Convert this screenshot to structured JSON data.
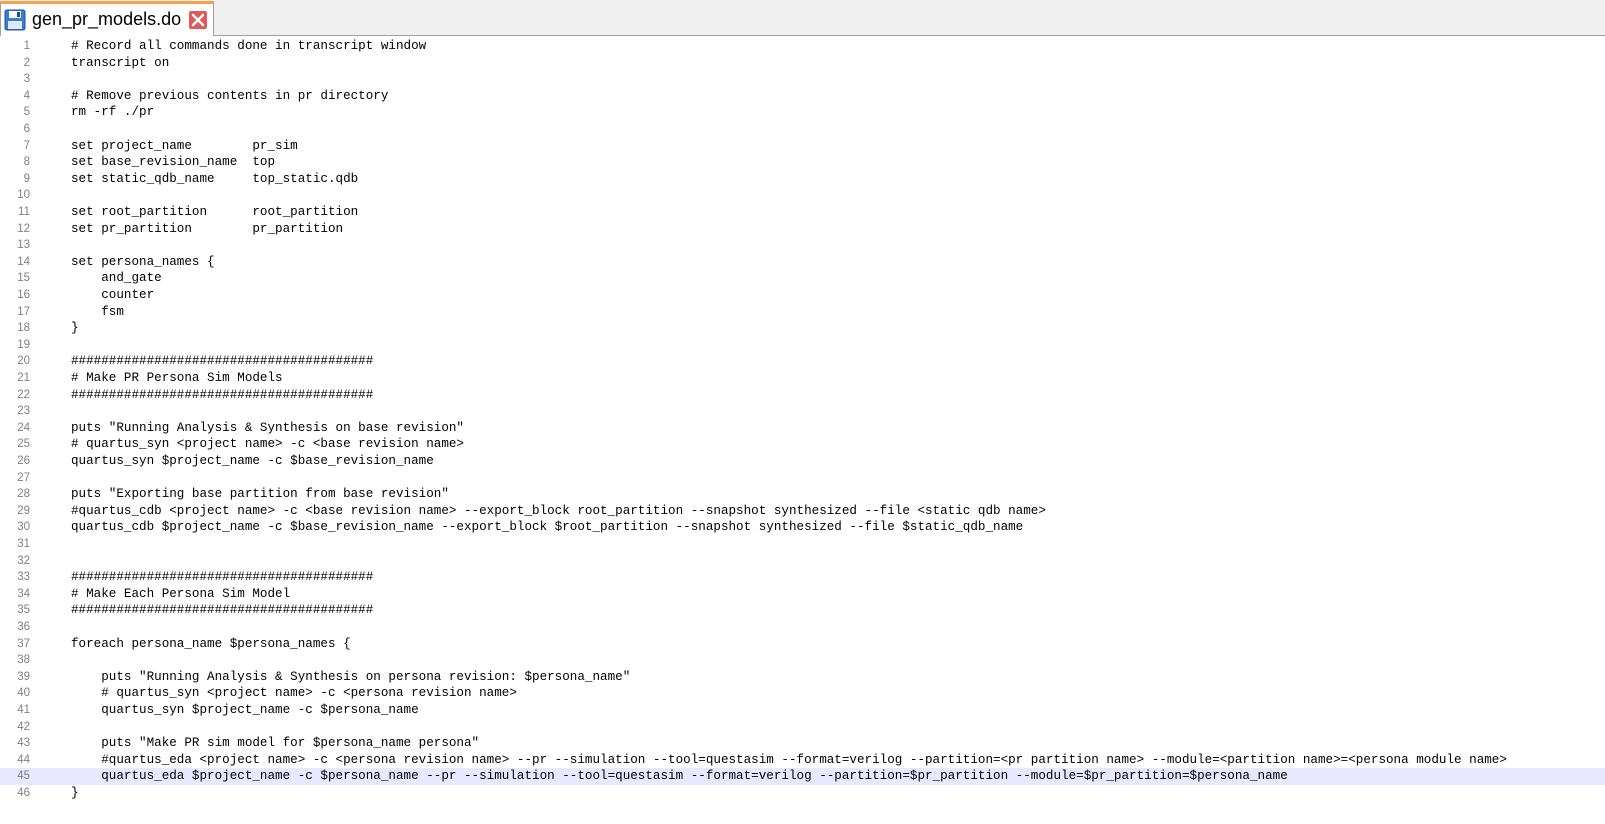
{
  "tab": {
    "filename": "gen_pr_models.do",
    "save_icon": "floppy-disk-icon",
    "close_icon": "close-icon"
  },
  "editor": {
    "current_line": 45,
    "lines": [
      "# Record all commands done in transcript window",
      "transcript on",
      "",
      "# Remove previous contents in pr directory",
      "rm -rf ./pr",
      "",
      "set project_name        pr_sim",
      "set base_revision_name  top",
      "set static_qdb_name     top_static.qdb",
      "",
      "set root_partition      root_partition",
      "set pr_partition        pr_partition",
      "",
      "set persona_names {",
      "    and_gate",
      "    counter",
      "    fsm",
      "}",
      "",
      "########################################",
      "# Make PR Persona Sim Models",
      "########################################",
      "",
      "puts \"Running Analysis & Synthesis on base revision\"",
      "# quartus_syn <project name> -c <base revision name>",
      "quartus_syn $project_name -c $base_revision_name",
      "",
      "puts \"Exporting base partition from base revision\"",
      "#quartus_cdb <project name> -c <base revision name> --export_block root_partition --snapshot synthesized --file <static qdb name>",
      "quartus_cdb $project_name -c $base_revision_name --export_block $root_partition --snapshot synthesized --file $static_qdb_name",
      "",
      "",
      "########################################",
      "# Make Each Persona Sim Model",
      "########################################",
      "",
      "foreach persona_name $persona_names {",
      "",
      "    puts \"Running Analysis & Synthesis on persona revision: $persona_name\"",
      "    # quartus_syn <project name> -c <persona revision name>",
      "    quartus_syn $project_name -c $persona_name",
      "",
      "    puts \"Make PR sim model for $persona_name persona\"",
      "    #quartus_eda <project name> -c <persona revision name> --pr --simulation --tool=questasim --format=verilog --partition=<pr partition name> --module=<partition name>=<persona module name>",
      "    quartus_eda $project_name -c $persona_name --pr --simulation --tool=questasim --format=verilog --partition=$pr_partition --module=$pr_partition=$persona_name",
      "}"
    ]
  },
  "colors": {
    "tab_accent": "#f7a24a",
    "current_line_bg": "#e8e8ff",
    "line_number": "#808080",
    "close_button": "#e05a5a"
  }
}
